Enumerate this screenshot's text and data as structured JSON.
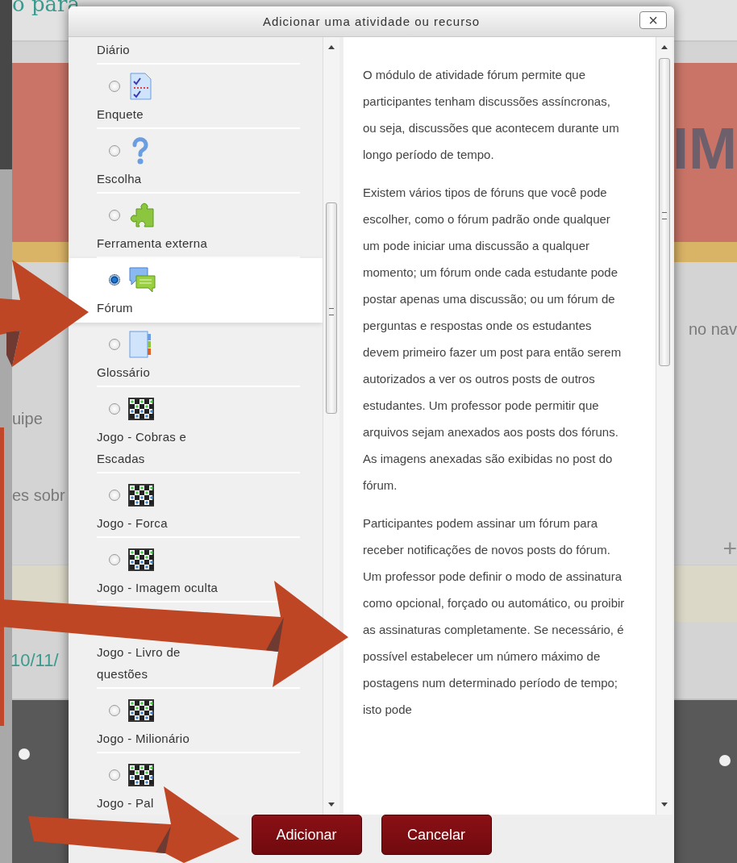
{
  "background": {
    "title_fragment": "o para",
    "banner_fragment": "IM",
    "team_fragment": "uipe",
    "info_fragment": "es sobr",
    "nav_fragment": "no nav",
    "add_sign": "+",
    "date_fragment": "10/11/"
  },
  "dialog": {
    "title": "Adicionar uma atividade ou recurso",
    "close": "×",
    "activities": [
      {
        "label": "Diário",
        "kind": "cut",
        "selected": false
      },
      {
        "label": "Enquete",
        "kind": "option",
        "selected": false
      },
      {
        "label": "Escolha",
        "kind": "option",
        "selected": false
      },
      {
        "label": "Ferramenta externa",
        "kind": "option",
        "selected": false
      },
      {
        "label": "Fórum",
        "kind": "option",
        "selected": true
      },
      {
        "label": "Glossário",
        "kind": "option",
        "selected": false
      },
      {
        "label": "Jogo - Cobras e Escadas",
        "kind": "option",
        "selected": false
      },
      {
        "label": "Jogo - Forca",
        "kind": "option",
        "selected": false
      },
      {
        "label": "Jogo - Imagem oculta",
        "kind": "option",
        "selected": false
      },
      {
        "label": "Jogo - Livro de questões",
        "kind": "covered"
      },
      {
        "label": "Jogo - Milionário",
        "kind": "option",
        "selected": false
      },
      {
        "label": "Jogo - Pal",
        "kind": "option",
        "selected": false
      }
    ],
    "description": [
      "O módulo de atividade fórum permite que participantes tenham discussões assíncronas, ou seja, discussões que acontecem durante um longo período de tempo.",
      "Existem vários tipos de fóruns que você pode escolher, como o fórum padrão onde qualquer um pode iniciar uma discussão a qualquer momento; um fórum onde cada estudante pode postar apenas uma discussão; ou um fórum de perguntas e respostas onde os estudantes devem primeiro fazer um post para então serem autorizados a ver os outros posts de outros estudantes. Um professor pode permitir que arquivos sejam anexados aos posts dos fóruns. As imagens anexadas são exibidas no post do fórum.",
      "Participantes podem assinar um fórum para receber notificações de novos posts do fórum. Um professor pode definir o modo de assinatura como opcional, forçado ou automático, ou proibir as assinaturas completamente. Se necessário, é possível estabelecer um número máximo de postagens num determinado período de tempo; isto pode"
    ],
    "buttons": [
      "Adicionar",
      "Cancelar"
    ]
  }
}
